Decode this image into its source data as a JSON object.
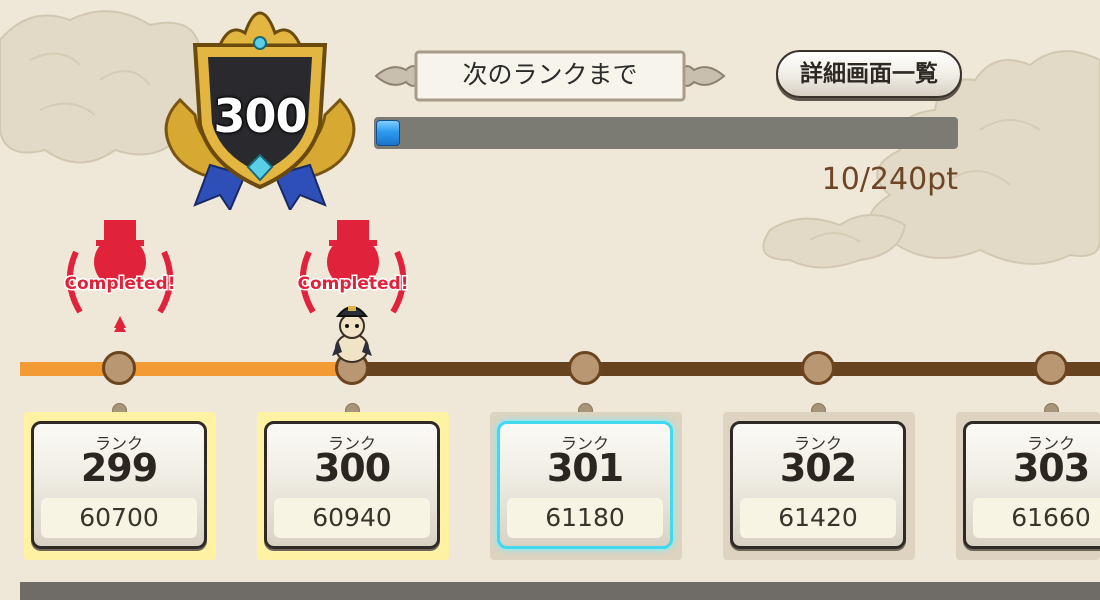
{
  "rank_emblem": {
    "value": "300"
  },
  "next_rank": {
    "label": "次のランクまで",
    "progress_fraction": 0.042,
    "progress_text": "10/240pt"
  },
  "detail_button": {
    "label": "詳細画面一覧"
  },
  "stamp_text": "Completed!",
  "track": {
    "completed_fraction": 0.3
  },
  "rank_cards": [
    {
      "label": "ランク",
      "rank": "299",
      "points": "60700",
      "state": "achieved"
    },
    {
      "label": "ランク",
      "rank": "300",
      "points": "60940",
      "state": "achieved"
    },
    {
      "label": "ランク",
      "rank": "301",
      "points": "61180",
      "state": "current"
    },
    {
      "label": "ランク",
      "rank": "302",
      "points": "61420",
      "state": "locked"
    },
    {
      "label": "ランク",
      "rank": "303",
      "points": "61660",
      "state": "locked"
    }
  ],
  "colors": {
    "track_done": "#f39a35",
    "track_base": "#67431f",
    "progress_fill": "#2d9bf0",
    "stamp_red": "#e0233a",
    "current_highlight": "#42d8f0"
  }
}
